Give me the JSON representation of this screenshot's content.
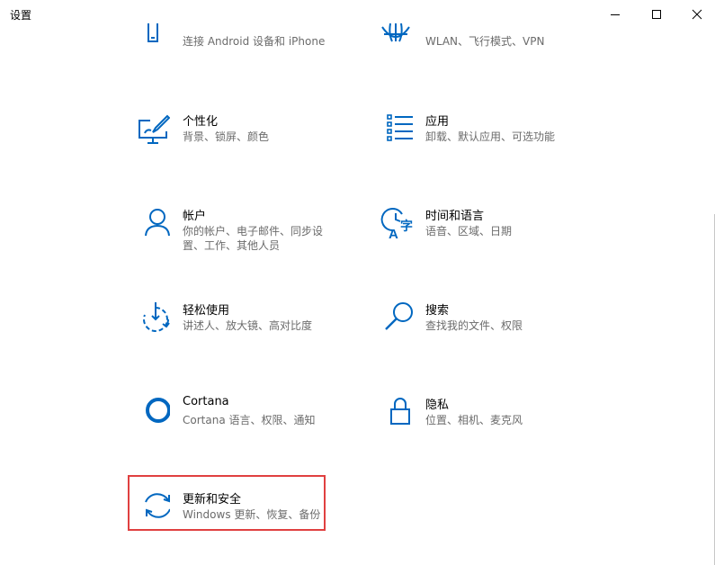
{
  "window": {
    "title": "设置",
    "minimize_icon": "minimize-icon",
    "maximize_icon": "maximize-icon",
    "close_icon": "close-icon"
  },
  "tiles": [
    {
      "id": "phone",
      "name": "",
      "desc": "连接 Android 设备和 iPhone",
      "icon": "phone-icon"
    },
    {
      "id": "network",
      "name": "",
      "desc": "WLAN、飞行模式、VPN",
      "icon": "globe-icon"
    },
    {
      "id": "personalization",
      "name": "个性化",
      "desc": "背景、锁屏、颜色",
      "icon": "paintbrush-monitor-icon"
    },
    {
      "id": "apps",
      "name": "应用",
      "desc": "卸载、默认应用、可选功能",
      "icon": "app-list-icon"
    },
    {
      "id": "accounts",
      "name": "帐户",
      "desc_line1": "你的帐户、电子邮件、同步设",
      "desc_line2": "置、工作、其他人员",
      "icon": "person-icon"
    },
    {
      "id": "time-language",
      "name": "时间和语言",
      "desc": "语音、区域、日期",
      "icon": "time-language-icon"
    },
    {
      "id": "ease-of-access",
      "name": "轻松使用",
      "desc": "讲述人、放大镜、高对比度",
      "icon": "ease-of-access-icon"
    },
    {
      "id": "search",
      "name": "搜索",
      "desc": "查找我的文件、权限",
      "icon": "search-icon"
    },
    {
      "id": "cortana",
      "name": "Cortana",
      "desc": "Cortana 语言、权限、通知",
      "icon": "cortana-icon"
    },
    {
      "id": "privacy",
      "name": "隐私",
      "desc": "位置、相机、麦克风",
      "icon": "lock-icon"
    },
    {
      "id": "update-security",
      "name": "更新和安全",
      "desc": "Windows 更新、恢复、备份",
      "icon": "sync-arrows-icon",
      "highlighted": true
    }
  ],
  "colors": {
    "accent": "#0067c0",
    "highlight_border": "#e04040",
    "desc_text": "#6b6b6b"
  }
}
